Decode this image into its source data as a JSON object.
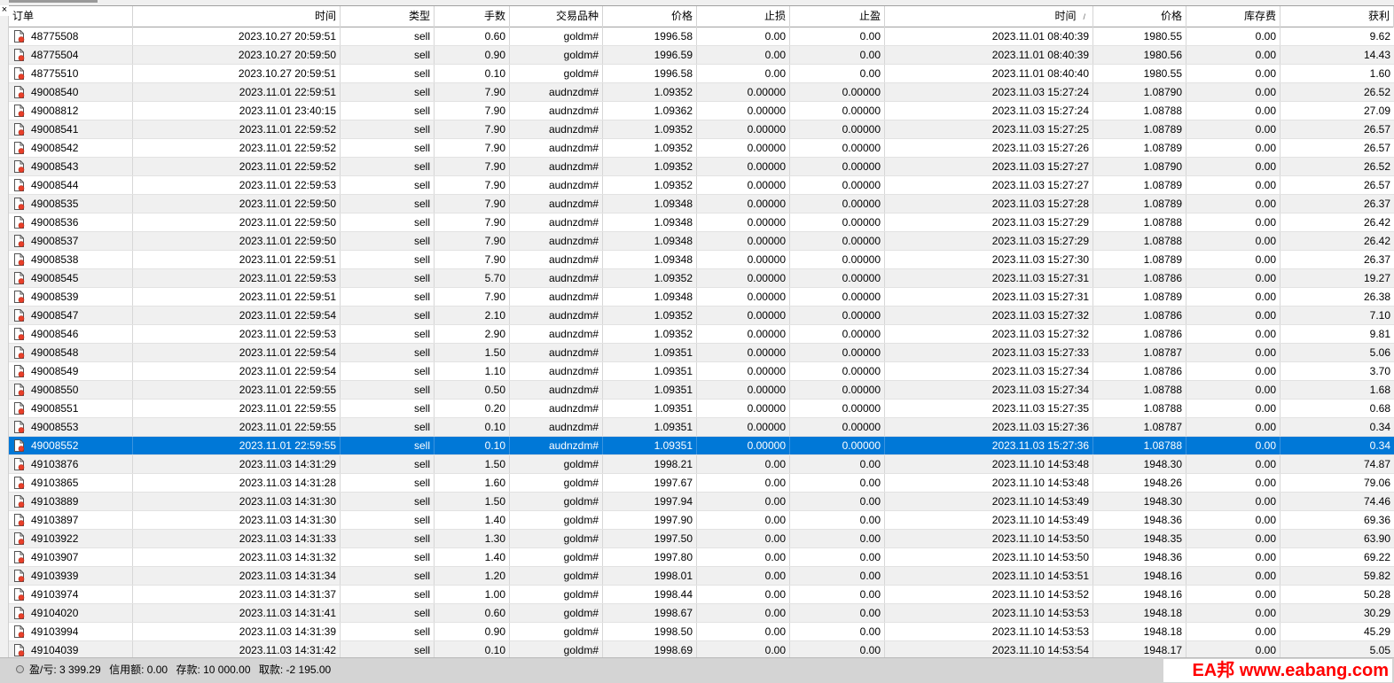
{
  "ui": {
    "close_glyph": "×"
  },
  "columns": [
    {
      "label": "订单"
    },
    {
      "label": "时间"
    },
    {
      "label": "类型"
    },
    {
      "label": "手数"
    },
    {
      "label": "交易品种"
    },
    {
      "label": "价格"
    },
    {
      "label": "止损"
    },
    {
      "label": "止盈"
    },
    {
      "label": "时间",
      "sort": "/"
    },
    {
      "label": "价格"
    },
    {
      "label": "库存费"
    },
    {
      "label": "获利"
    }
  ],
  "selected_row": 22,
  "icons": {
    "row": "document-order-icon",
    "status": "circle-status-icon"
  },
  "rows": [
    [
      "48775508",
      "2023.10.27 20:59:51",
      "sell",
      "0.60",
      "goldm#",
      "1996.58",
      "0.00",
      "0.00",
      "2023.11.01 08:40:39",
      "1980.55",
      "0.00",
      "9.62"
    ],
    [
      "48775504",
      "2023.10.27 20:59:50",
      "sell",
      "0.90",
      "goldm#",
      "1996.59",
      "0.00",
      "0.00",
      "2023.11.01 08:40:39",
      "1980.56",
      "0.00",
      "14.43"
    ],
    [
      "48775510",
      "2023.10.27 20:59:51",
      "sell",
      "0.10",
      "goldm#",
      "1996.58",
      "0.00",
      "0.00",
      "2023.11.01 08:40:40",
      "1980.55",
      "0.00",
      "1.60"
    ],
    [
      "49008540",
      "2023.11.01 22:59:51",
      "sell",
      "7.90",
      "audnzdm#",
      "1.09352",
      "0.00000",
      "0.00000",
      "2023.11.03 15:27:24",
      "1.08790",
      "0.00",
      "26.52"
    ],
    [
      "49008812",
      "2023.11.01 23:40:15",
      "sell",
      "7.90",
      "audnzdm#",
      "1.09362",
      "0.00000",
      "0.00000",
      "2023.11.03 15:27:24",
      "1.08788",
      "0.00",
      "27.09"
    ],
    [
      "49008541",
      "2023.11.01 22:59:52",
      "sell",
      "7.90",
      "audnzdm#",
      "1.09352",
      "0.00000",
      "0.00000",
      "2023.11.03 15:27:25",
      "1.08789",
      "0.00",
      "26.57"
    ],
    [
      "49008542",
      "2023.11.01 22:59:52",
      "sell",
      "7.90",
      "audnzdm#",
      "1.09352",
      "0.00000",
      "0.00000",
      "2023.11.03 15:27:26",
      "1.08789",
      "0.00",
      "26.57"
    ],
    [
      "49008543",
      "2023.11.01 22:59:52",
      "sell",
      "7.90",
      "audnzdm#",
      "1.09352",
      "0.00000",
      "0.00000",
      "2023.11.03 15:27:27",
      "1.08790",
      "0.00",
      "26.52"
    ],
    [
      "49008544",
      "2023.11.01 22:59:53",
      "sell",
      "7.90",
      "audnzdm#",
      "1.09352",
      "0.00000",
      "0.00000",
      "2023.11.03 15:27:27",
      "1.08789",
      "0.00",
      "26.57"
    ],
    [
      "49008535",
      "2023.11.01 22:59:50",
      "sell",
      "7.90",
      "audnzdm#",
      "1.09348",
      "0.00000",
      "0.00000",
      "2023.11.03 15:27:28",
      "1.08789",
      "0.00",
      "26.37"
    ],
    [
      "49008536",
      "2023.11.01 22:59:50",
      "sell",
      "7.90",
      "audnzdm#",
      "1.09348",
      "0.00000",
      "0.00000",
      "2023.11.03 15:27:29",
      "1.08788",
      "0.00",
      "26.42"
    ],
    [
      "49008537",
      "2023.11.01 22:59:50",
      "sell",
      "7.90",
      "audnzdm#",
      "1.09348",
      "0.00000",
      "0.00000",
      "2023.11.03 15:27:29",
      "1.08788",
      "0.00",
      "26.42"
    ],
    [
      "49008538",
      "2023.11.01 22:59:51",
      "sell",
      "7.90",
      "audnzdm#",
      "1.09348",
      "0.00000",
      "0.00000",
      "2023.11.03 15:27:30",
      "1.08789",
      "0.00",
      "26.37"
    ],
    [
      "49008545",
      "2023.11.01 22:59:53",
      "sell",
      "5.70",
      "audnzdm#",
      "1.09352",
      "0.00000",
      "0.00000",
      "2023.11.03 15:27:31",
      "1.08786",
      "0.00",
      "19.27"
    ],
    [
      "49008539",
      "2023.11.01 22:59:51",
      "sell",
      "7.90",
      "audnzdm#",
      "1.09348",
      "0.00000",
      "0.00000",
      "2023.11.03 15:27:31",
      "1.08789",
      "0.00",
      "26.38"
    ],
    [
      "49008547",
      "2023.11.01 22:59:54",
      "sell",
      "2.10",
      "audnzdm#",
      "1.09352",
      "0.00000",
      "0.00000",
      "2023.11.03 15:27:32",
      "1.08786",
      "0.00",
      "7.10"
    ],
    [
      "49008546",
      "2023.11.01 22:59:53",
      "sell",
      "2.90",
      "audnzdm#",
      "1.09352",
      "0.00000",
      "0.00000",
      "2023.11.03 15:27:32",
      "1.08786",
      "0.00",
      "9.81"
    ],
    [
      "49008548",
      "2023.11.01 22:59:54",
      "sell",
      "1.50",
      "audnzdm#",
      "1.09351",
      "0.00000",
      "0.00000",
      "2023.11.03 15:27:33",
      "1.08787",
      "0.00",
      "5.06"
    ],
    [
      "49008549",
      "2023.11.01 22:59:54",
      "sell",
      "1.10",
      "audnzdm#",
      "1.09351",
      "0.00000",
      "0.00000",
      "2023.11.03 15:27:34",
      "1.08786",
      "0.00",
      "3.70"
    ],
    [
      "49008550",
      "2023.11.01 22:59:55",
      "sell",
      "0.50",
      "audnzdm#",
      "1.09351",
      "0.00000",
      "0.00000",
      "2023.11.03 15:27:34",
      "1.08788",
      "0.00",
      "1.68"
    ],
    [
      "49008551",
      "2023.11.01 22:59:55",
      "sell",
      "0.20",
      "audnzdm#",
      "1.09351",
      "0.00000",
      "0.00000",
      "2023.11.03 15:27:35",
      "1.08788",
      "0.00",
      "0.68"
    ],
    [
      "49008553",
      "2023.11.01 22:59:55",
      "sell",
      "0.10",
      "audnzdm#",
      "1.09351",
      "0.00000",
      "0.00000",
      "2023.11.03 15:27:36",
      "1.08787",
      "0.00",
      "0.34"
    ],
    [
      "49008552",
      "2023.11.01 22:59:55",
      "sell",
      "0.10",
      "audnzdm#",
      "1.09351",
      "0.00000",
      "0.00000",
      "2023.11.03 15:27:36",
      "1.08788",
      "0.00",
      "0.34"
    ],
    [
      "49103876",
      "2023.11.03 14:31:29",
      "sell",
      "1.50",
      "goldm#",
      "1998.21",
      "0.00",
      "0.00",
      "2023.11.10 14:53:48",
      "1948.30",
      "0.00",
      "74.87"
    ],
    [
      "49103865",
      "2023.11.03 14:31:28",
      "sell",
      "1.60",
      "goldm#",
      "1997.67",
      "0.00",
      "0.00",
      "2023.11.10 14:53:48",
      "1948.26",
      "0.00",
      "79.06"
    ],
    [
      "49103889",
      "2023.11.03 14:31:30",
      "sell",
      "1.50",
      "goldm#",
      "1997.94",
      "0.00",
      "0.00",
      "2023.11.10 14:53:49",
      "1948.30",
      "0.00",
      "74.46"
    ],
    [
      "49103897",
      "2023.11.03 14:31:30",
      "sell",
      "1.40",
      "goldm#",
      "1997.90",
      "0.00",
      "0.00",
      "2023.11.10 14:53:49",
      "1948.36",
      "0.00",
      "69.36"
    ],
    [
      "49103922",
      "2023.11.03 14:31:33",
      "sell",
      "1.30",
      "goldm#",
      "1997.50",
      "0.00",
      "0.00",
      "2023.11.10 14:53:50",
      "1948.35",
      "0.00",
      "63.90"
    ],
    [
      "49103907",
      "2023.11.03 14:31:32",
      "sell",
      "1.40",
      "goldm#",
      "1997.80",
      "0.00",
      "0.00",
      "2023.11.10 14:53:50",
      "1948.36",
      "0.00",
      "69.22"
    ],
    [
      "49103939",
      "2023.11.03 14:31:34",
      "sell",
      "1.20",
      "goldm#",
      "1998.01",
      "0.00",
      "0.00",
      "2023.11.10 14:53:51",
      "1948.16",
      "0.00",
      "59.82"
    ],
    [
      "49103974",
      "2023.11.03 14:31:37",
      "sell",
      "1.00",
      "goldm#",
      "1998.44",
      "0.00",
      "0.00",
      "2023.11.10 14:53:52",
      "1948.16",
      "0.00",
      "50.28"
    ],
    [
      "49104020",
      "2023.11.03 14:31:41",
      "sell",
      "0.60",
      "goldm#",
      "1998.67",
      "0.00",
      "0.00",
      "2023.11.10 14:53:53",
      "1948.18",
      "0.00",
      "30.29"
    ],
    [
      "49103994",
      "2023.11.03 14:31:39",
      "sell",
      "0.90",
      "goldm#",
      "1998.50",
      "0.00",
      "0.00",
      "2023.11.10 14:53:53",
      "1948.18",
      "0.00",
      "45.29"
    ],
    [
      "49104039",
      "2023.11.03 14:31:42",
      "sell",
      "0.10",
      "goldm#",
      "1998.69",
      "0.00",
      "0.00",
      "2023.11.10 14:53:54",
      "1948.17",
      "0.00",
      "5.05"
    ]
  ],
  "status": {
    "profit": "盈/亏: 3 399.29",
    "credit": "信用额: 0.00",
    "deposit": "存款: 10 000.00",
    "withdrawal": "取款: -2 195.00"
  },
  "watermark": {
    "text": "EA邦 www.eabang.com",
    "color": "#ff0000"
  },
  "colors": {
    "selection": "#0078d7",
    "alt_row": "#f0f0f0",
    "status_bar": "#d4d4d4"
  }
}
